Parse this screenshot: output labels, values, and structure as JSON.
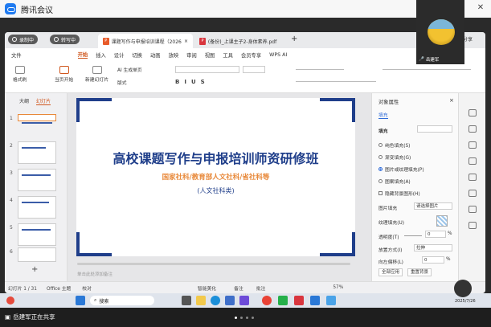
{
  "meeting": {
    "app_title": "腾讯会议"
  },
  "video": {
    "participant_name": "岳建军"
  },
  "share_bar": {
    "status": "岳建军正在共享"
  },
  "wps": {
    "badges": {
      "rec1": "录制中",
      "rec2": "转写中"
    },
    "tabs": [
      {
        "label": "课题写作与申报培训课程（2026年..."
      },
      {
        "label": "(备份)_上课主子2-身体素养.pdf"
      }
    ],
    "tab_close": "×",
    "new_tab": "+",
    "share_btn": "分享",
    "menu": [
      "文件",
      "开始",
      "插入",
      "设计",
      "切换",
      "动画",
      "放映",
      "审阅",
      "视图",
      "工具",
      "会员专享",
      "WPS AI"
    ],
    "ribbon": {
      "format": "格式刷",
      "current": "当页开始",
      "new_slide": "新建幻灯片",
      "ai_gen": "AI 生成单页",
      "layout": "版式"
    },
    "left_panel": {
      "tab_outline": "大纲",
      "tab_slides": "幻灯片",
      "slide_numbers": [
        "1",
        "2",
        "3",
        "4",
        "5",
        "6"
      ]
    },
    "slide": {
      "title": "高校课题写作与申报培训师资研修班",
      "subtitle": "国家社科/教育部人文社科/省社科等",
      "category": "(人文社科类)"
    },
    "notes_placeholder": "单击此处添加备注",
    "right_panel": {
      "title": "对象属性",
      "tab": "填充",
      "fill_label": "填充",
      "options": [
        "纯色填充(S)",
        "渐变填充(G)",
        "图片或纹理填充(P)",
        "图案填充(A)"
      ],
      "hide_bg": "隐藏背景图形(H)",
      "picture_fill": "图片填充",
      "picture_fill_value": "请选择图片",
      "texture_fill": "纹理填充(U)",
      "transparency": "透明度(T)",
      "transparency_value": "0",
      "transparency_unit": "%",
      "placement": "放置方式(I)",
      "placement_value": "拉伸",
      "offset": "向左偏移(L)",
      "offset_value": "0",
      "offset_unit": "%",
      "apply_all": "全部应用",
      "reset_bg": "重置背景"
    },
    "status": {
      "slide_count": "幻灯片 1 / 31",
      "theme": "Office 主题",
      "proofing": "校对",
      "beautify": "智能美化",
      "notes": "备注",
      "comments": "批注",
      "zoom": "57%"
    }
  },
  "taskbar": {
    "search": "搜索",
    "time": "2025/7/26"
  }
}
